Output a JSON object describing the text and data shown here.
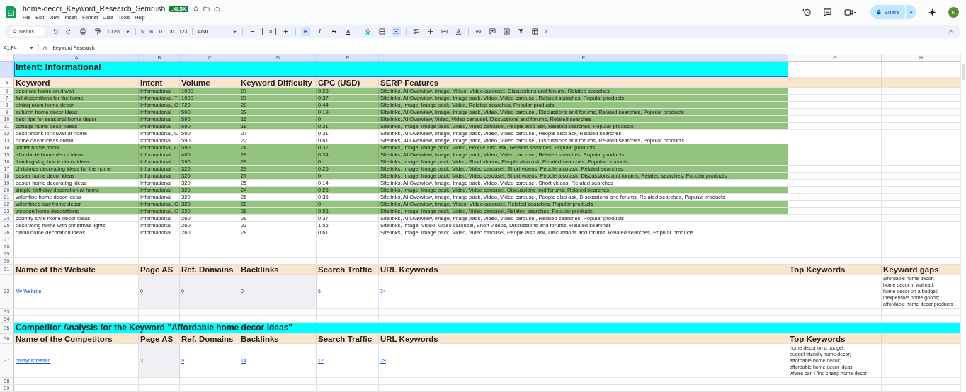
{
  "app": {
    "title": "home-decor_Keyword_Research_Semrush",
    "badge": ".XLSX",
    "menu": [
      "File",
      "Edit",
      "View",
      "Insert",
      "Format",
      "Data",
      "Tools",
      "Help"
    ],
    "share": "Share",
    "avatar": "N"
  },
  "toolbar": {
    "search": {
      "placeholder": "Menus"
    },
    "zoom": "100%",
    "currency": "$",
    "percent": "%",
    "decrease_decimals": ".0",
    "increase_decimals": ".00",
    "number_format": "123",
    "font": "Arial",
    "font_size": "18",
    "bold": {
      "label": "B",
      "on": true
    },
    "italic": {
      "label": "I",
      "on": false
    },
    "strikethrough": {
      "label": "S",
      "on": false
    },
    "text_color": {
      "label": "A"
    },
    "merge_on": true,
    "sum": "Σ"
  },
  "formula_bar": {
    "cell_range": "A1:F4",
    "fx": "fx",
    "value": "Keyword Research"
  },
  "sheet": {
    "columns": [
      {
        "label": "A",
        "selected": true
      },
      {
        "label": "B",
        "selected": true
      },
      {
        "label": "C",
        "selected": true
      },
      {
        "label": "D",
        "selected": true
      },
      {
        "label": "E",
        "selected": true
      },
      {
        "label": "F",
        "selected": true
      },
      {
        "label": "G",
        "selected": false
      },
      {
        "label": "H",
        "selected": false
      }
    ],
    "rows": [
      {
        "kind": "banner",
        "title": "Intent: Informational",
        "full_width": false,
        "selected": true
      },
      {
        "kind": "header",
        "number": "5",
        "cells": [
          "Keyword",
          "Intent",
          "Volume",
          "Keyword Difficulty",
          "CPC (USD)",
          "SERP Features",
          null,
          null
        ]
      },
      {
        "kind": "keyword",
        "number": "6",
        "highlighted": true,
        "cells": [
          "decorate home on diwali",
          "Informational",
          "1000",
          "27",
          "0.28",
          "Sitelinks, AI Overview, Image, Video, Video carousel, Discussions and forums, Related searches"
        ]
      },
      {
        "kind": "keyword",
        "number": "7",
        "highlighted": true,
        "cells": [
          "fall decorations for the home",
          "Informational, T",
          "1000",
          "27",
          "0.37",
          "Sitelinks, AI Overview, Image, Image pack, Video, Video carousel, Related searches, Popular products"
        ]
      },
      {
        "kind": "keyword",
        "number": "8",
        "highlighted": true,
        "cells": [
          "dining room home decor",
          "Informational, C",
          "720",
          "28",
          "0.44",
          "Sitelinks, Image, Image pack, Video, Related searches, Popular products"
        ]
      },
      {
        "kind": "keyword",
        "number": "9",
        "highlighted": true,
        "cells": [
          "autumn home decor ideas",
          "Informational",
          "590",
          "23",
          "0.19",
          "Sitelinks, AI Overview, Image, Image pack, Video, Video carousel, Discussions and forums, Related searches, Popular products"
        ]
      },
      {
        "kind": "keyword",
        "number": "10",
        "highlighted": true,
        "cells": [
          "best tips for seasonal home decor",
          "Informational",
          "590",
          "16",
          "0",
          "Sitelinks, AI Overview, Video, Video carousel, Discussions and forums, Related searches"
        ]
      },
      {
        "kind": "keyword",
        "number": "11",
        "highlighted": true,
        "cells": [
          "cottage home decor ideas",
          "Informational",
          "590",
          "18",
          "0.21",
          "Sitelinks, Image, Image pack, Video, Video carousel, People also ask, Related searches, Popular products"
        ]
      },
      {
        "kind": "keyword",
        "number": "12",
        "highlighted": false,
        "cells": [
          "decorations for diwali at home",
          "Informational, C",
          "590",
          "27",
          "0.31",
          "Sitelinks, AI Overview, Image, Image pack, Video, Video carousel, People also ask, Related searches"
        ]
      },
      {
        "kind": "keyword",
        "number": "13",
        "highlighted": false,
        "cells": [
          "home decor ideas diwali",
          "Informational",
          "590",
          "22",
          "0.61",
          "Sitelinks, AI Overview, Image, Image pack, Video, Video carousel, Discussions and forums, Related searches, Popular products"
        ]
      },
      {
        "kind": "keyword",
        "number": "14",
        "highlighted": true,
        "cells": [
          "winter home decor",
          "Informational, C",
          "590",
          "24",
          "0.32",
          "Sitelinks, Image, Image pack, Video, People also ask, Related searches, Popular products"
        ]
      },
      {
        "kind": "keyword",
        "number": "15",
        "highlighted": true,
        "cells": [
          "affordable home decor ideas",
          "Informational",
          "480",
          "28",
          "0.34",
          "Sitelinks, AI Overview, Image, Image pack, Video, Video carousel, Related searches, Popular products"
        ]
      },
      {
        "kind": "keyword",
        "number": "16",
        "highlighted": true,
        "cells": [
          "thanksgiving home decor ideas",
          "Informational",
          "390",
          "28",
          "0",
          "Sitelinks, Image, Image pack, Video, Short videos, People also ask, Related searches, Popular products"
        ]
      },
      {
        "kind": "keyword",
        "number": "17",
        "highlighted": true,
        "cells": [
          "christmas decorating ideas for the home",
          "Informational",
          "320",
          "29",
          "0.25",
          "Sitelinks, Image, Image pack, Video, Video carousel, Short videos, People also ask, Related searches"
        ]
      },
      {
        "kind": "keyword",
        "number": "18",
        "highlighted": true,
        "cells": [
          "easter home decor ideas",
          "Informational",
          "320",
          "27",
          "0",
          "Sitelinks, Image, Image pack, Video, Video carousel, Short videos, People also ask, Discussions and forums, Related searches, Popular products"
        ]
      },
      {
        "kind": "keyword",
        "number": "19",
        "highlighted": false,
        "cells": [
          "easter home decorating ideas",
          "Informational",
          "320",
          "25",
          "0.14",
          "Sitelinks, AI Overview, Image, Image pack, Video, Video carousel, Short videos, Related searches"
        ]
      },
      {
        "kind": "keyword",
        "number": "20",
        "highlighted": true,
        "cells": [
          "simple birthday decoration at home",
          "Informational",
          "320",
          "24",
          "0.25",
          "Sitelinks, Image, Image pack, Video, Video carousel, Discussions and forums, Related searches"
        ]
      },
      {
        "kind": "keyword",
        "number": "21",
        "highlighted": false,
        "cells": [
          "valentine home decor ideas",
          "Informational",
          "320",
          "26",
          "0.35",
          "Sitelinks, AI Overview, Image, Image pack, Video, Video carousel, People also ask, Discussions and forums, Related searches, Popular products"
        ]
      },
      {
        "kind": "keyword",
        "number": "22",
        "highlighted": true,
        "cells": [
          "valentine's day home decor",
          "Informational, C",
          "320",
          "22",
          "0",
          "Sitelinks, AI Overview, Image, Video, Video carousel, Related searches, Popular products"
        ]
      },
      {
        "kind": "keyword",
        "number": "23",
        "highlighted": true,
        "cells": [
          "wooden home decorations",
          "Informational, C",
          "320",
          "29",
          "0.55",
          "Sitelinks, Image, Image pack, Video, Video carousel, Related searches, Popular products"
        ]
      },
      {
        "kind": "keyword",
        "number": "24",
        "highlighted": false,
        "cells": [
          "country style home decor ideas",
          "Informational",
          "260",
          "29",
          "0.37",
          "Sitelinks, AI Overview, Image, Image pack, Video, Video carousel, Related searches, Popular products"
        ]
      },
      {
        "kind": "keyword",
        "number": "25",
        "highlighted": false,
        "cells": [
          "decorating home with christmas lights",
          "Informational",
          "260",
          "23",
          "1.55",
          "Sitelinks, Image, Video, Video carousel, Short videos, Discussions and forums, Related searches"
        ]
      },
      {
        "kind": "keyword",
        "number": "26",
        "highlighted": false,
        "cells": [
          "diwali home decoration ideas",
          "Informational",
          "260",
          "28",
          "0.61",
          "Sitelinks, Image, Image pack, Video, Video carousel, People also ask, Discussions and forums, Related searches, Popular products"
        ]
      },
      {
        "kind": "blank",
        "number": "27"
      },
      {
        "kind": "blank",
        "number": "28"
      },
      {
        "kind": "blank",
        "number": "29"
      },
      {
        "kind": "blank",
        "number": "30"
      },
      {
        "kind": "header",
        "number": "31",
        "cells": [
          "Name of the Website",
          "Page AS",
          "Ref. Domains",
          "Backlinks",
          "Search Traffic",
          "URL Keywords",
          "Top Keywords",
          "Keyword gaps"
        ]
      },
      {
        "kind": "entry",
        "number": "32",
        "cells": [
          {
            "text": "My Website",
            "link": true,
            "shaded": false
          },
          {
            "text": "0",
            "link": false,
            "shaded": true
          },
          {
            "text": "0",
            "link": false,
            "shaded": true
          },
          {
            "text": "0",
            "link": false,
            "shaded": true
          },
          {
            "text": "6",
            "link": true,
            "shaded": false
          },
          {
            "text": "34",
            "link": true,
            "shaded": false
          },
          null,
          {
            "lines": [
              "affordable home decor;",
              "home decor in walmart;",
              "home decor on a budget;",
              "inexpensive home goods;",
              "affordable home decor products"
            ]
          }
        ]
      },
      {
        "kind": "blank",
        "number": "33"
      },
      {
        "kind": "blank",
        "number": "34"
      },
      {
        "kind": "banner",
        "number": "35",
        "title": "Competitor Analysis for the Keyword \"Affordable home decor ideas\"",
        "full_width": true,
        "selected": false
      },
      {
        "kind": "header",
        "number": "36",
        "cells": [
          "Name of the Competitors",
          "Page AS",
          "Ref. Domains",
          "Backlinks",
          "Search Traffic",
          "URL Keywords",
          "Top Keywords",
          null
        ]
      },
      {
        "kind": "entry",
        "number": "37",
        "cells": [
          {
            "text": "prettydistressed",
            "link": true,
            "shaded": false
          },
          {
            "text": "3",
            "link": false,
            "shaded": true
          },
          {
            "text": "9",
            "link": true,
            "shaded": false
          },
          {
            "text": "14",
            "link": true,
            "shaded": false
          },
          {
            "text": "12",
            "link": true,
            "shaded": false
          },
          {
            "text": "29",
            "link": true,
            "shaded": false
          },
          {
            "lines": [
              "home decor on a budget;",
              "budget friendly home decor;",
              "affordable home decor;",
              "affordable home decor ideas;",
              "where can i find cheap home decor"
            ]
          },
          null
        ]
      },
      {
        "kind": "blank",
        "number": "38"
      },
      {
        "kind": "blank",
        "number": "39"
      }
    ]
  }
}
